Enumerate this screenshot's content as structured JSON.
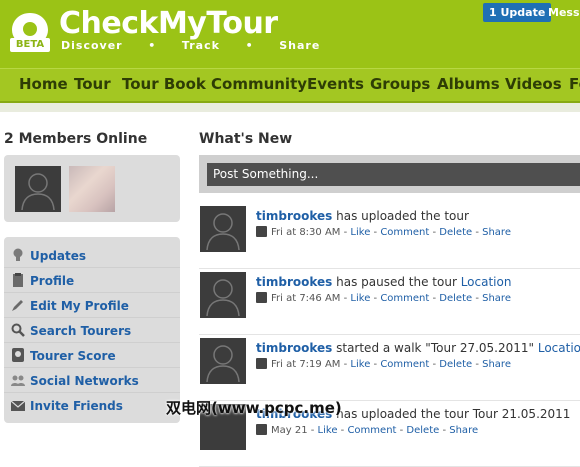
{
  "header": {
    "brand": "CheckMyTour",
    "beta": "BETA",
    "tagline": "Discover  •  Track  •  Share",
    "update_button": "1 Update",
    "messages_button": "Messa",
    "colors": {
      "brand_green": "#9bc316",
      "link_blue": "#1f5fa6"
    }
  },
  "nav": {
    "items": [
      "Home",
      "Tour",
      "Tour Book",
      "Community",
      "Events",
      "Groups",
      "Albums",
      "Videos",
      "Fo"
    ]
  },
  "sidebar": {
    "members_title": "2 Members Online",
    "menu": [
      {
        "label": "Updates",
        "icon": "lightbulb-icon"
      },
      {
        "label": "Profile",
        "icon": "clipboard-icon"
      },
      {
        "label": "Edit My Profile",
        "icon": "pencil-icon"
      },
      {
        "label": "Search Tourers",
        "icon": "magnifier-icon"
      },
      {
        "label": "Tourer Score",
        "icon": "map-pin-icon"
      },
      {
        "label": "Social Networks",
        "icon": "people-icon"
      },
      {
        "label": "Invite Friends",
        "icon": "envelope-icon"
      }
    ]
  },
  "feed": {
    "title": "What's New",
    "post_placeholder": "Post Something...",
    "items": [
      {
        "user": "timbrookes",
        "text": " has uploaded the tour",
        "link": "",
        "time": "Fri at 8:30 AM",
        "icon": "upload-icon"
      },
      {
        "user": "timbrookes",
        "text": " has paused the tour ",
        "link": "Location",
        "time": "Fri at 7:46 AM",
        "icon": "pause-icon"
      },
      {
        "user": "timbrookes",
        "text": " started a walk \"Tour 27.05.2011\" ",
        "link": "Location",
        "time": "Fri at 7:19 AM",
        "icon": "play-icon"
      },
      {
        "user": "timbrookes",
        "text": " has uploaded the tour Tour 21.05.2011",
        "link": "",
        "time": "May 21",
        "icon": "upload-icon"
      }
    ],
    "actions": {
      "like": "Like",
      "comment": "Comment",
      "delete": "Delete",
      "share": "Share"
    }
  },
  "watermark": "双电网(www.pcpc.me)"
}
